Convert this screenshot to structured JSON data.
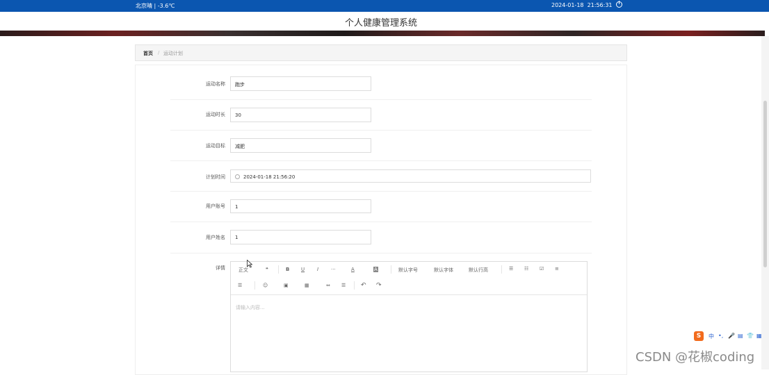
{
  "topbar": {
    "weather": "北京晴 | -3.6℃",
    "date": "2024-01-18",
    "time": "21:56:31",
    "power_icon": "power-icon"
  },
  "header": {
    "title": "个人健康管理系统"
  },
  "breadcrumb": {
    "home": "首页",
    "separator": "/",
    "current": "运动计划"
  },
  "form": {
    "name_label": "运动名称",
    "name_value": "跑步",
    "duration_label": "运动时长",
    "duration_value": "30",
    "goal_label": "运动目标",
    "goal_value": "减肥",
    "plan_time_label": "计划时间",
    "plan_time_value": "2024-01-18 21:56:20",
    "account_label": "用户账号",
    "account_value": "1",
    "username_label": "用户姓名",
    "username_value": "1",
    "detail_label": "详情"
  },
  "editor": {
    "paragraph": "正文",
    "quote": "❝",
    "bold": "B",
    "underline": "U",
    "italic": "I",
    "more": "···",
    "font_color": "A",
    "bg_color": "A",
    "font_size": "默认字号",
    "font_family": "默认字体",
    "line_height": "默认行高",
    "bullet_list": "☰",
    "ordered_list": "☷",
    "todo": "☑",
    "align": "≡",
    "indent": "☰",
    "emoji": "☺",
    "image": "▣",
    "table": "▦",
    "link": "⇔",
    "divider": "☰",
    "undo": "↶",
    "redo": "↷",
    "placeholder": "请输入内容..."
  },
  "ime": {
    "lang": "中",
    "icons": [
      "•,",
      "🎤",
      "▤",
      "👕",
      "▦"
    ]
  },
  "watermark": "CSDN @花椒coding"
}
